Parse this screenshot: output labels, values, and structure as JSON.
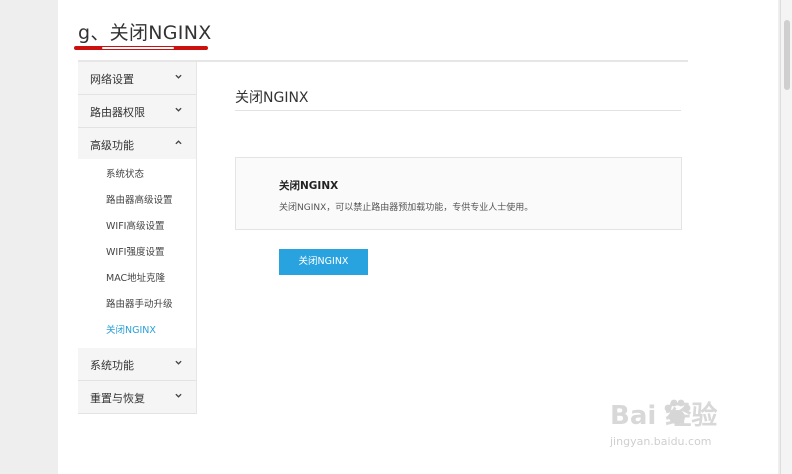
{
  "step_title": "g、关闭NGINX",
  "sidebar": {
    "sections": [
      {
        "label": "网络设置",
        "chevron": "down"
      },
      {
        "label": "路由器权限",
        "chevron": "down"
      },
      {
        "label": "高级功能",
        "chevron": "up"
      },
      {
        "label": "系统功能",
        "chevron": "down"
      },
      {
        "label": "重置与恢复",
        "chevron": "down"
      }
    ],
    "advanced_items": [
      {
        "label": "系统状态",
        "active": false
      },
      {
        "label": "路由器高级设置",
        "active": false
      },
      {
        "label": "WIFI高级设置",
        "active": false
      },
      {
        "label": "WIFI强度设置",
        "active": false
      },
      {
        "label": "MAC地址克隆",
        "active": false
      },
      {
        "label": "路由器手动升级",
        "active": false
      },
      {
        "label": "关闭NGINX",
        "active": true
      }
    ]
  },
  "main": {
    "title": "关闭NGINX",
    "info_heading": "关闭NGINX",
    "info_desc": "关闭NGINX，可以禁止路由器预加载功能，专供专业人士使用。",
    "button_label": "关闭NGINX"
  },
  "watermark": {
    "brand": "Bai  经验",
    "url": "jingyan.baidu.com"
  },
  "colors": {
    "accent": "#29a3e0",
    "active_link": "#2a9fd6",
    "annotation_red": "#cc1010"
  },
  "icons": {
    "chevron_down": "chevron-down-icon",
    "chevron_up": "chevron-up-icon",
    "paw": "paw-icon"
  }
}
